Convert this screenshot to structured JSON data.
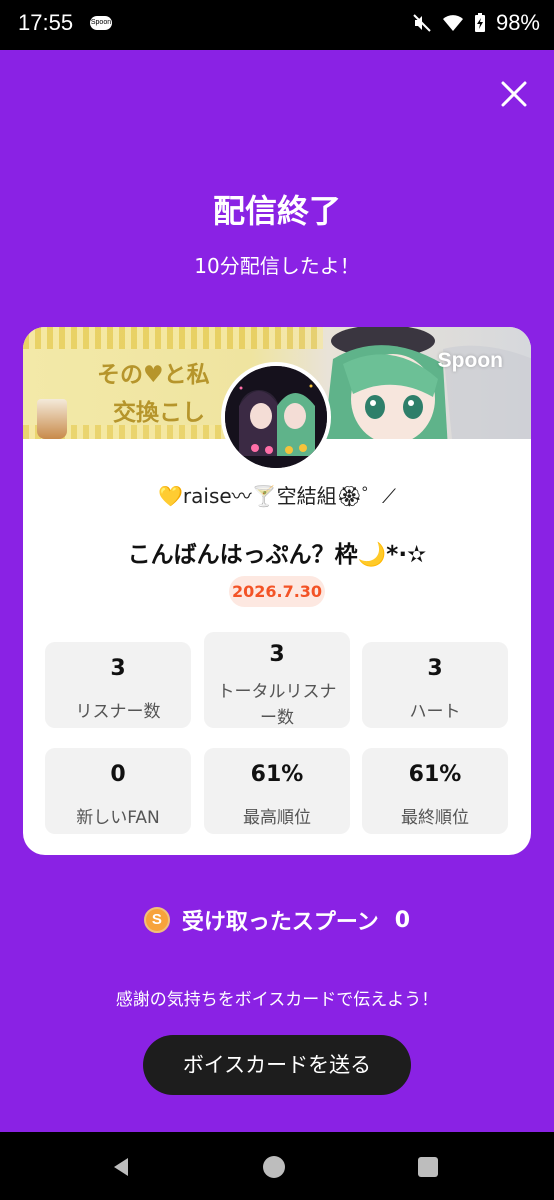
{
  "status_bar": {
    "time": "17:55",
    "app_icon_text": "Spoon",
    "battery": "98%"
  },
  "header": {
    "title": "配信終了",
    "subtitle": "10分配信したよ！"
  },
  "card": {
    "banner_line1": "その♥と私",
    "banner_line2": "交換こし",
    "brand": "Spoon",
    "username": "💛raise〰🍸空結組🏵゜⟋",
    "stream_title": "こんばんはっぷん？枠🌙*·✫",
    "date": "2026.7.30",
    "stats": [
      {
        "value": "3",
        "label": "リスナー数"
      },
      {
        "value": "3",
        "label": "トータルリスナー数"
      },
      {
        "value": "3",
        "label": "ハート"
      },
      {
        "value": "0",
        "label": "新しいFAN"
      },
      {
        "value": "61%",
        "label": "最高順位"
      },
      {
        "value": "61%",
        "label": "最終順位"
      }
    ]
  },
  "spoons": {
    "coin_letter": "S",
    "label": "受け取ったスプーン",
    "count": "0"
  },
  "footer": {
    "thanks_text": "感謝の気持ちをボイスカードで伝えよう！",
    "voice_card_button": "ボイスカードを送る"
  },
  "colors": {
    "background": "#8a22e4",
    "date_badge_text": "#f35326",
    "date_badge_bg": "#fde8e1",
    "button_bg": "#1d1d1d"
  }
}
